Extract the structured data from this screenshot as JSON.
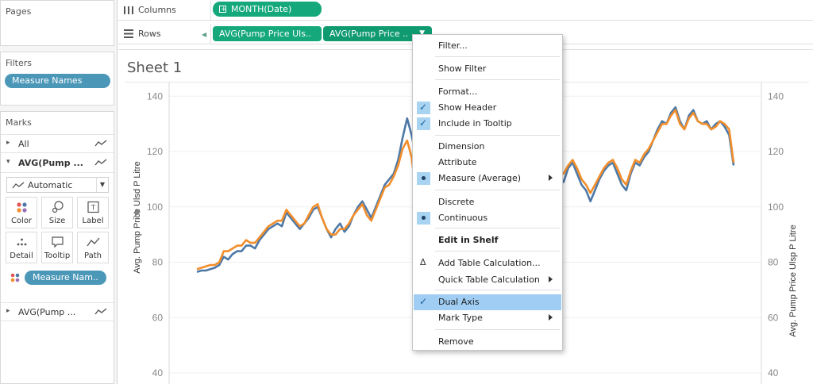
{
  "left": {
    "pages": {
      "title": "Pages"
    },
    "filters": {
      "title": "Filters",
      "pill": "Measure Names"
    },
    "marks": {
      "title": "Marks",
      "rows": [
        {
          "label": "All",
          "bold": false
        },
        {
          "label": "AVG(Pump ...",
          "bold": true
        },
        {
          "label": "AVG(Pump ...",
          "bold": false
        }
      ],
      "mark_type": "Automatic",
      "buttons": [
        {
          "label": "Color",
          "icon": "color-dots-icon"
        },
        {
          "label": "Size",
          "icon": "size-icon"
        },
        {
          "label": "Label",
          "icon": "label-icon"
        },
        {
          "label": "Detail",
          "icon": "detail-icon"
        },
        {
          "label": "Tooltip",
          "icon": "tooltip-icon"
        },
        {
          "label": "Path",
          "icon": "path-icon"
        }
      ],
      "color_pill": "Measure Nam.."
    }
  },
  "shelves": {
    "columns": {
      "label": "Columns",
      "pills": [
        "MONTH(Date)"
      ]
    },
    "rows": {
      "label": "Rows",
      "pills": [
        "AVG(Pump Price Uls..",
        "AVG(Pump Price .."
      ]
    }
  },
  "sheet": {
    "title": "Sheet 1"
  },
  "chart_data": {
    "type": "line",
    "xlabel": "",
    "ylabel_left": "Avg. Pump Price Ulsd P Litre",
    "ylabel_right": "Avg. Pump Price Ulsp P Litre",
    "y_left_ticks": [
      "40",
      "60",
      "80",
      "100",
      "120",
      "140"
    ],
    "y_right_ticks": [
      "40",
      "60",
      "80",
      "100",
      "120",
      "140"
    ],
    "ylim_left": [
      36,
      157
    ],
    "ylim_right": [
      36,
      157
    ],
    "dual_axis": true,
    "grid": true,
    "series": [
      {
        "color": "#4e79a7",
        "axis": "left",
        "values": [
          76.5,
          77,
          77,
          77.5,
          78,
          79,
          82,
          81,
          83,
          84,
          84,
          86,
          86,
          85,
          88,
          90,
          92,
          93,
          94,
          93,
          98,
          96,
          94,
          92,
          94,
          96,
          99,
          100,
          96,
          92,
          89,
          92,
          94,
          91,
          93,
          97,
          100,
          102,
          99,
          96,
          100,
          104,
          108,
          110,
          112,
          117,
          125,
          132,
          126,
          118,
          103,
          96,
          99,
          102,
          105,
          108,
          110,
          112,
          115,
          114,
          118,
          120,
          123,
          126,
          129,
          132,
          131,
          128,
          127,
          128,
          126,
          128,
          130,
          128,
          127,
          125,
          122,
          121,
          118,
          116,
          114,
          111,
          109,
          114,
          116,
          112,
          108,
          106,
          102,
          106,
          110,
          113,
          115,
          116,
          112,
          108,
          106,
          112,
          116,
          115,
          118,
          120,
          124,
          128,
          131,
          130,
          134,
          136,
          131,
          128,
          133,
          135,
          131,
          130,
          131,
          128,
          130,
          131,
          129,
          126,
          115
        ]
      },
      {
        "color": "#f28e2b",
        "axis": "right",
        "values": [
          77.5,
          78,
          78.5,
          79,
          79,
          80,
          84,
          84,
          85,
          86,
          86,
          88,
          87,
          87,
          89,
          91,
          93,
          94,
          95,
          95,
          99,
          97,
          95,
          93,
          94,
          97,
          100,
          101,
          96,
          92,
          90,
          90,
          92,
          92,
          94,
          97,
          99,
          101,
          97,
          95,
          99,
          103,
          107,
          108,
          111,
          115,
          121,
          124,
          118,
          105,
          95,
          91,
          95,
          99,
          102,
          106,
          108,
          110,
          113,
          112,
          116,
          119,
          122,
          124,
          127,
          129,
          128,
          126,
          125,
          126,
          124,
          126,
          128,
          126,
          126,
          124,
          122,
          120,
          118,
          117,
          115,
          113,
          112,
          115,
          117,
          114,
          110,
          108,
          105,
          108,
          111,
          114,
          116,
          117,
          114,
          110,
          108,
          113,
          117,
          116,
          119,
          121,
          124,
          127,
          130,
          130,
          133,
          135,
          130,
          128,
          132,
          134,
          131,
          130,
          130,
          128,
          129,
          131,
          130,
          128,
          116
        ]
      }
    ]
  },
  "context_menu": {
    "items": [
      {
        "label": "Filter...",
        "mark": "",
        "bold": false,
        "submenu": false
      },
      {
        "label": "Show Filter",
        "mark": "",
        "bold": false,
        "submenu": false
      },
      {
        "label": "Format...",
        "mark": "",
        "bold": false,
        "submenu": false
      },
      {
        "label": "Show Header",
        "mark": "check",
        "bold": false,
        "submenu": false
      },
      {
        "label": "Include in Tooltip",
        "mark": "check",
        "bold": false,
        "submenu": false
      },
      {
        "label": "Dimension",
        "mark": "",
        "bold": false,
        "submenu": false
      },
      {
        "label": "Attribute",
        "mark": "",
        "bold": false,
        "submenu": false
      },
      {
        "label": "Measure (Average)",
        "mark": "dot",
        "bold": false,
        "submenu": true
      },
      {
        "label": "Discrete",
        "mark": "",
        "bold": false,
        "submenu": false
      },
      {
        "label": "Continuous",
        "mark": "dot",
        "bold": false,
        "submenu": false
      },
      {
        "label": "Edit in Shelf",
        "mark": "",
        "bold": true,
        "submenu": false
      },
      {
        "label": "Add Table Calculation...",
        "mark": "delta",
        "bold": false,
        "submenu": false
      },
      {
        "label": "Quick Table Calculation",
        "mark": "",
        "bold": false,
        "submenu": true
      },
      {
        "label": "Dual Axis",
        "mark": "check",
        "bold": false,
        "submenu": false,
        "highlighted": true
      },
      {
        "label": "Mark Type",
        "mark": "",
        "bold": false,
        "submenu": true
      },
      {
        "label": "Remove",
        "mark": "",
        "bold": false,
        "submenu": false
      }
    ]
  },
  "colors": {
    "pill_green": "#15a87b",
    "pill_blue": "#4b97b8",
    "menu_highlight": "#9fcdf3"
  }
}
